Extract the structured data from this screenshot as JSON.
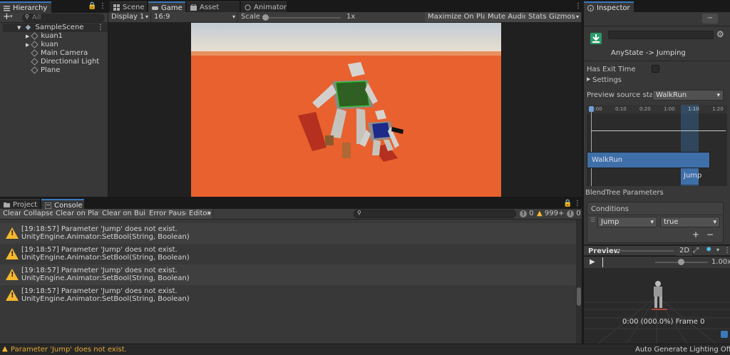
{
  "hierarchy": {
    "tab_label": "Hierarchy",
    "search_placeholder": "All",
    "add_label": "+",
    "scene": "SampleScene",
    "items": [
      "kuan1",
      "kuan",
      "Main Camera",
      "Directional Light",
      "Plane"
    ]
  },
  "center_tabs": [
    "Scene",
    "Game",
    "Asset Store",
    "Animator"
  ],
  "game_toolbar": {
    "display": "Display 1",
    "aspect": "16:9",
    "scale_label": "Scale",
    "scale_value": "1x",
    "maximize": "Maximize On Play",
    "mute": "Mute Audio",
    "stats": "Stats",
    "gizmos": "Gizmos"
  },
  "bottom_tabs": [
    "Project",
    "Console"
  ],
  "console_toolbar": {
    "clear": "Clear",
    "collapse": "Collapse",
    "clear_on_play": "Clear on Play",
    "clear_on_build": "Clear on Build",
    "error_pause": "Error Pause",
    "editor": "Editor",
    "error_count": "0",
    "warning_count": "999+",
    "info_count": "0"
  },
  "logs": [
    {
      "line1": "[19:18:57] Parameter 'Jump' does not exist.",
      "line2": "UnityEngine.Animator:SetBool(String, Boolean)"
    },
    {
      "line1": "[19:18:57] Parameter 'Jump' does not exist.",
      "line2": "UnityEngine.Animator:SetBool(String, Boolean)"
    },
    {
      "line1": "[19:18:57] Parameter 'Jump' does not exist.",
      "line2": "UnityEngine.Animator:SetBool(String, Boolean)"
    },
    {
      "line1": "[19:18:57] Parameter 'Jump' does not exist.",
      "line2": "UnityEngine.Animator:SetBool(String, Boolean)"
    }
  ],
  "inspector": {
    "tab_label": "Inspector",
    "transition_title": "AnyState -> Jumping",
    "has_exit_time": "Has Exit Time",
    "settings": "Settings",
    "preview_source_label": "Preview source state",
    "preview_source_value": "WalkRun",
    "timeline_ticks": [
      "0:00",
      "0:10",
      "0:20",
      "1:00",
      "1:10",
      "1:20"
    ],
    "walkrun_label": "WalkRun",
    "jump_label": "Jump",
    "blendtree": "BlendTree Parameters",
    "conditions": "Conditions",
    "condition_param": "Jump",
    "condition_value": "true",
    "add": "+",
    "remove": "−",
    "preview_label": "Preview",
    "preview_2d": "2D",
    "preview_speed": "1.00x",
    "preview_status": "0:00 (000.0%) Frame 0"
  },
  "status": {
    "message": "Parameter 'Jump' does not exist.",
    "right": "Auto Generate Lighting Off"
  },
  "colors": {
    "accent": "#3a79bb",
    "warning": "#f5b82e",
    "ground": "#e8612e"
  }
}
